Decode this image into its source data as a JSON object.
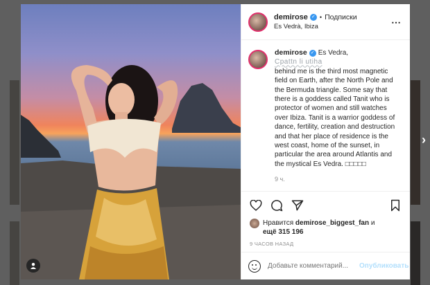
{
  "post": {
    "username": "demirose",
    "follow_sep": "•",
    "follow_label": "Подписки",
    "location": "Es Vedrà, Ibiza",
    "more_icon": "⋯",
    "caption_location": "Es Vedra,",
    "caption_smudge": "Cpattn li utiha",
    "caption_text": "behind me is the third most magnetic field on Earth, after the North Pole and the Bermuda triangle. Some say that there is a goddess called Tanit who is protector of women and still watches over Ibiza. Tanit is a warrior goddess of dance, fertility, creation and destruction and that her place of residence is the west coast, home of the sunset, in particular the area around Atlantis and the mystical Es Vedra. □□□□□",
    "caption_time": "9 ч.",
    "likes_prefix": "Нравится",
    "likes_user": "demirose_biggest_fan",
    "likes_mid": "и",
    "likes_count": "ещё 315 196",
    "posted_ago": "9 часов назад",
    "comment_placeholder": "Добавьте комментарий...",
    "post_button": "Опубликовать",
    "next_arrow": "›"
  },
  "colors": {
    "accent": "#3897f0",
    "post_button_disabled": "#b2dffc",
    "overlay": "rgba(0,0,0,0.62)"
  },
  "icons": [
    "heart-icon",
    "comment-icon",
    "share-icon",
    "bookmark-icon",
    "emoji-icon",
    "user-tag-icon",
    "more-icon",
    "verified-icon",
    "next-arrow-icon"
  ]
}
